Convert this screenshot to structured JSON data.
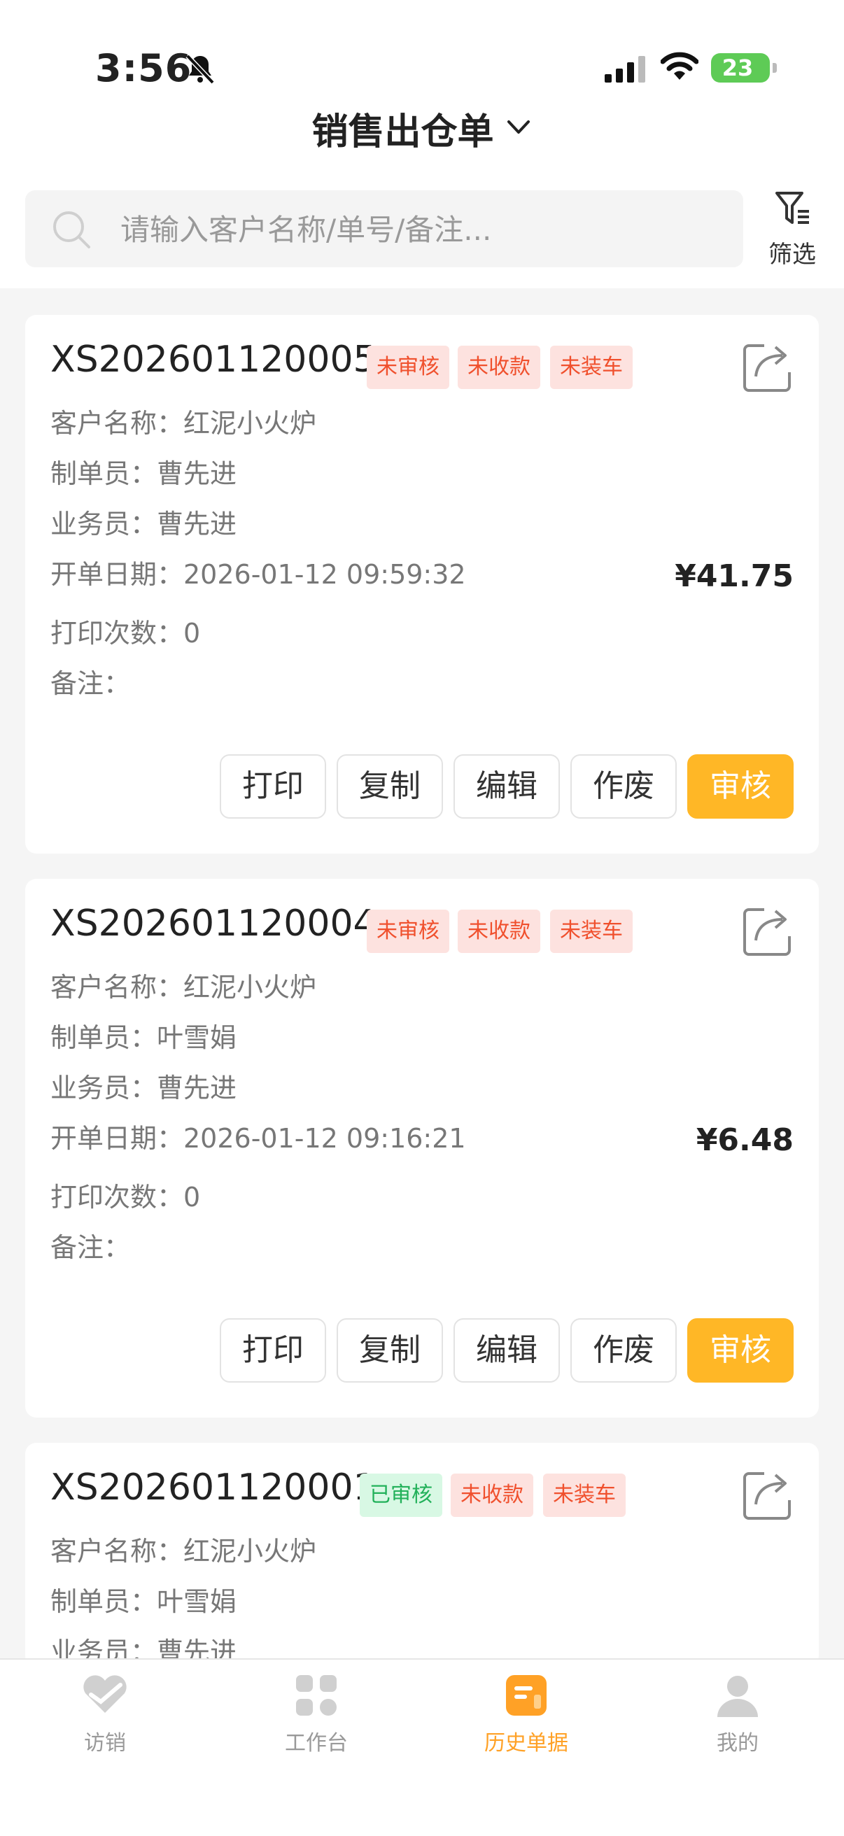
{
  "status_bar": {
    "time": "3:56",
    "battery": "23"
  },
  "header": {
    "title": "销售出仓单"
  },
  "search": {
    "placeholder": "请输入客户名称/单号/备注..."
  },
  "filter": {
    "label": "筛选"
  },
  "orders": [
    {
      "number": "XS202601120005",
      "badges": [
        {
          "label": "未审核",
          "color": "#f0502d"
        },
        {
          "label": "未收款",
          "color": "#f0502d"
        },
        {
          "label": "未装车",
          "color": "#f0502d"
        }
      ],
      "fields": [
        "客户名称：红泥小火炉",
        "制单员：曹先进",
        "业务员：曹先进",
        "开单日期：2026-01-12 09:59:32",
        "打印次数：0",
        "备注："
      ],
      "amount": "¥41.75",
      "actions": [
        "打印",
        "复制",
        "编辑",
        "作废",
        "审核"
      ]
    },
    {
      "number": "XS202601120004",
      "badges": [
        {
          "label": "未审核",
          "color": "#f0502d"
        },
        {
          "label": "未收款",
          "color": "#f0502d"
        },
        {
          "label": "未装车",
          "color": "#f0502d"
        }
      ],
      "fields": [
        "客户名称：红泥小火炉",
        "制单员：叶雪娟",
        "业务员：曹先进",
        "开单日期：2026-01-12 09:16:21",
        "打印次数：0",
        "备注："
      ],
      "amount": "¥6.48",
      "actions": [
        "打印",
        "复制",
        "编辑",
        "作废",
        "审核"
      ]
    },
    {
      "number": "XS202601120001",
      "badges": [
        {
          "label": "已审核",
          "color": "#22b15a"
        },
        {
          "label": "未收款",
          "color": "#f0502d"
        },
        {
          "label": "未装车",
          "color": "#f0502d"
        }
      ],
      "fields": [
        "客户名称：红泥小火炉",
        "制单员：叶雪娟",
        "业务员：曹先进"
      ]
    }
  ],
  "tabbar": {
    "items": [
      {
        "label": "访销",
        "icon": "visit-sales-icon"
      },
      {
        "label": "工作台",
        "icon": "workbench-icon"
      },
      {
        "label": "历史单据",
        "icon": "history-docs-icon",
        "active": true
      },
      {
        "label": "我的",
        "icon": "profile-icon"
      }
    ]
  },
  "colors": {
    "accent": "#ffb726",
    "active_tab": "#ffa126"
  }
}
